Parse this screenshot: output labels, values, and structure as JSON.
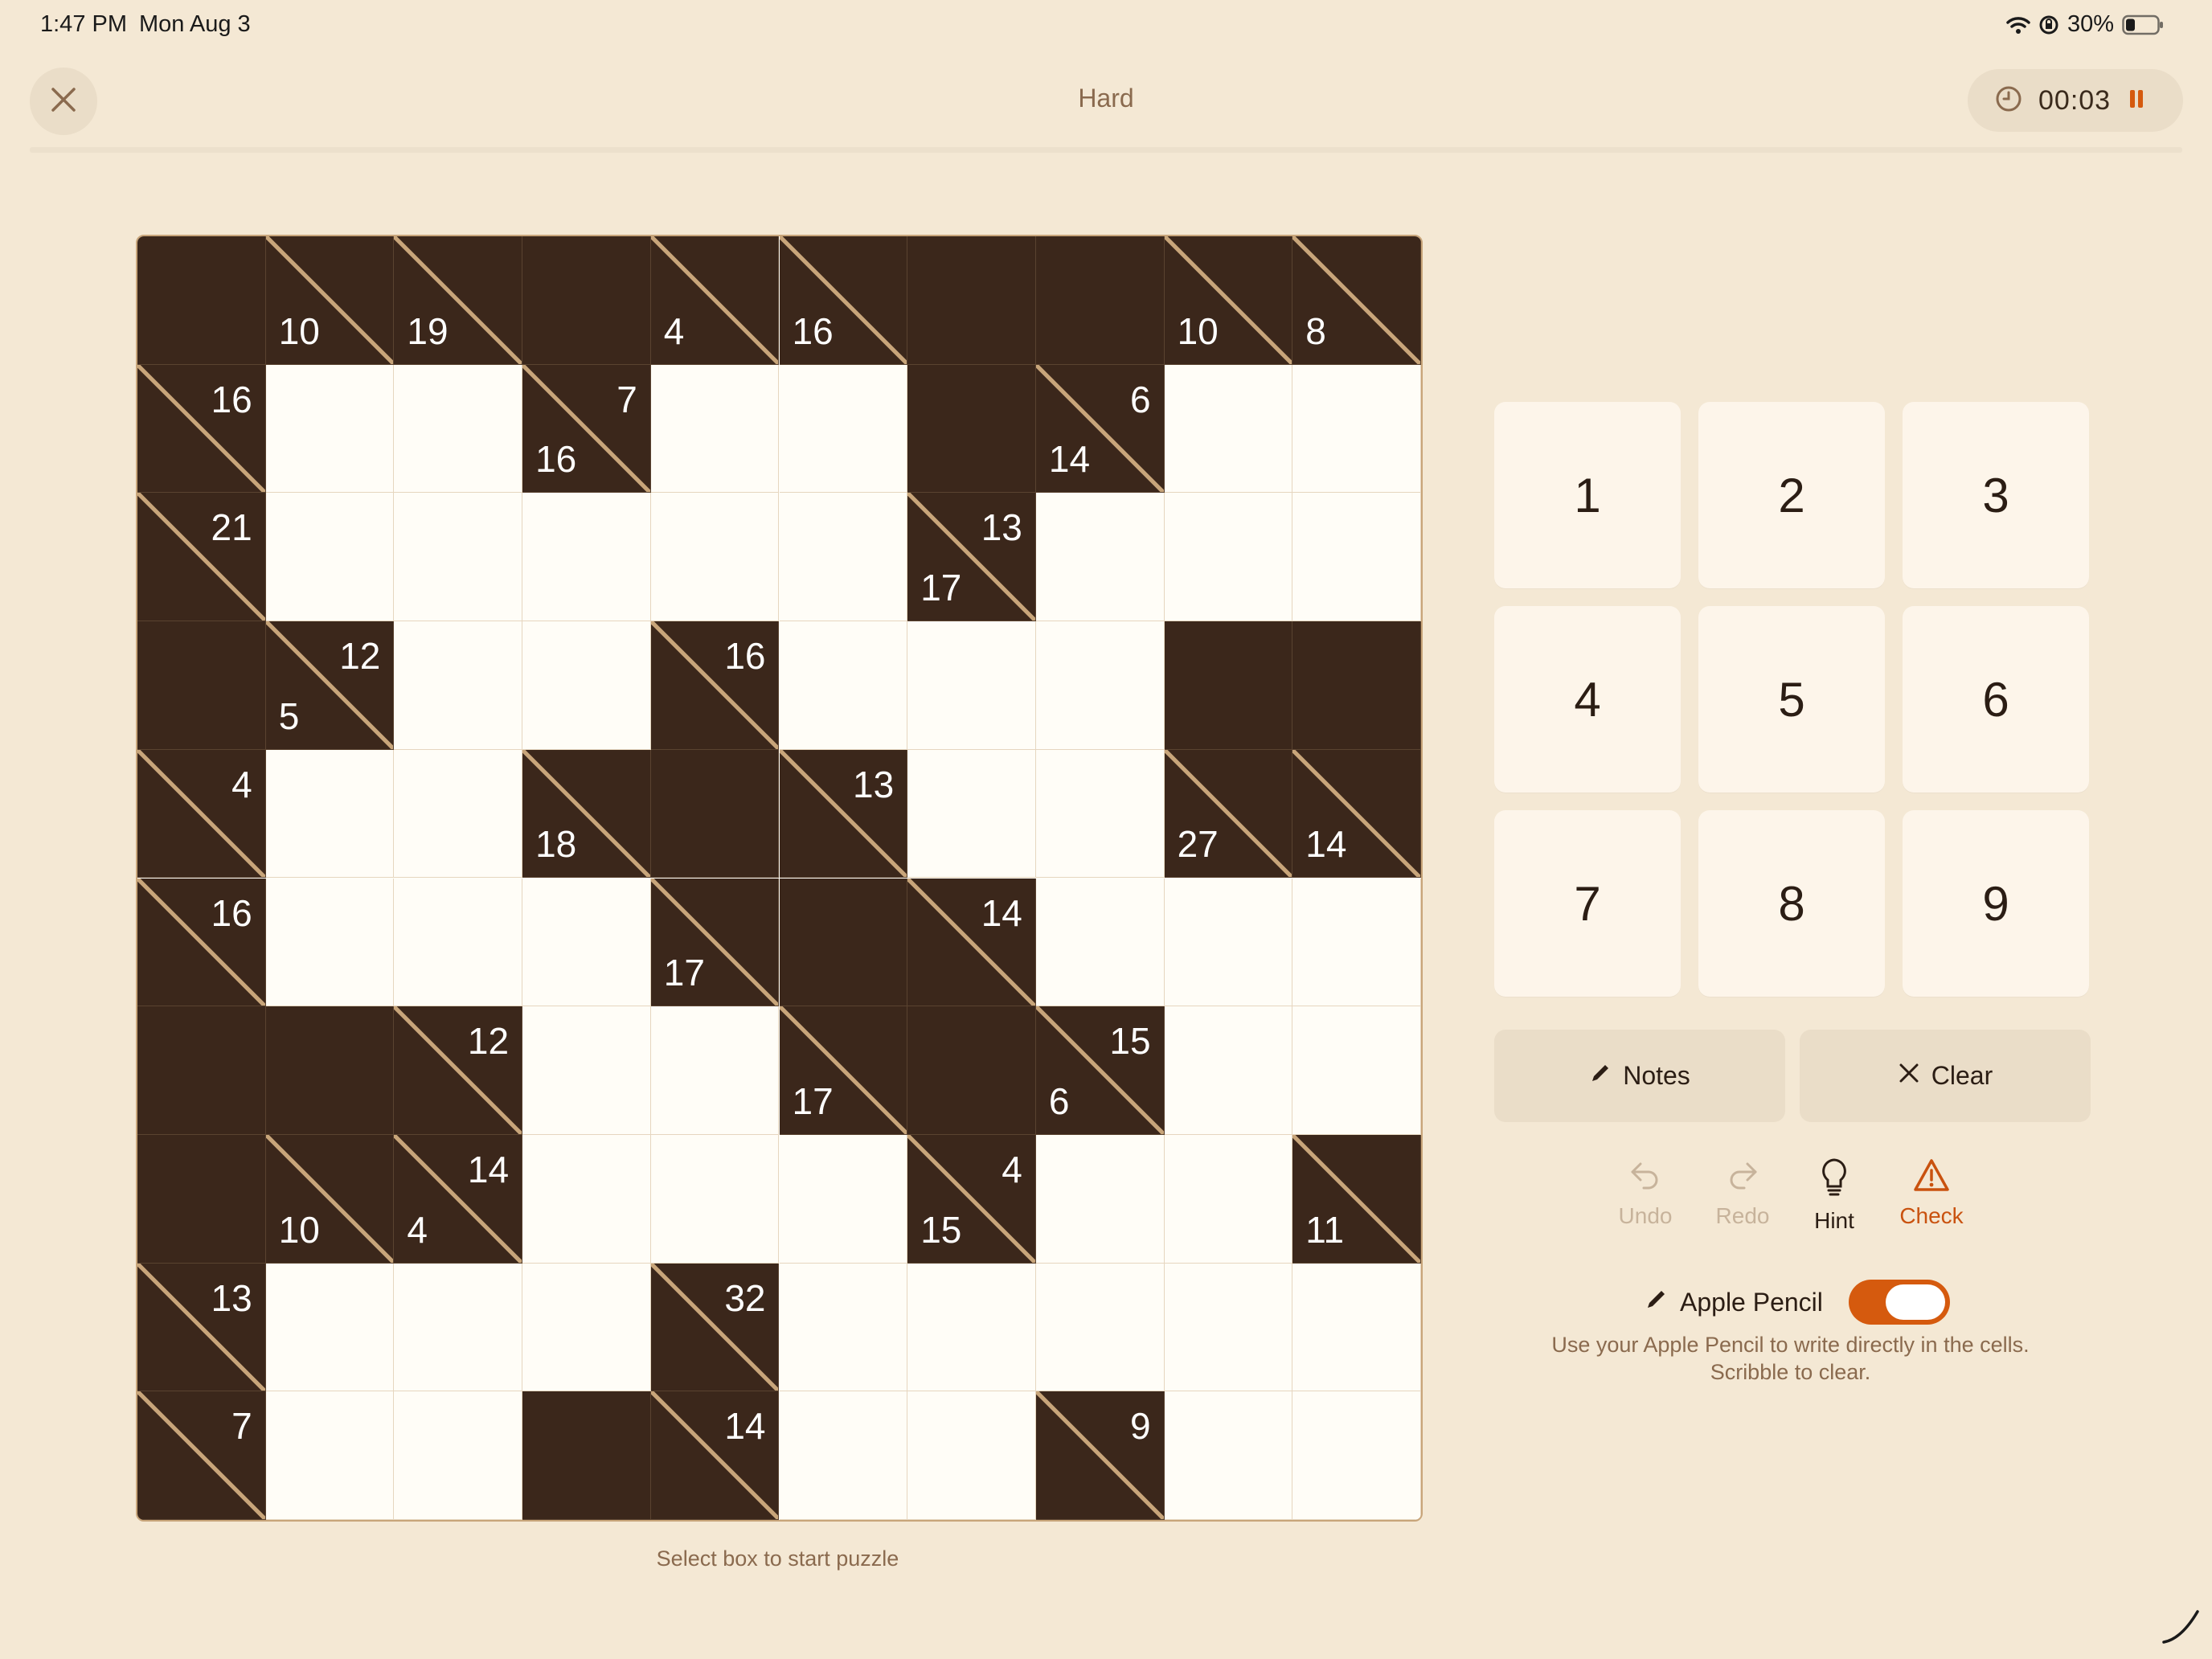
{
  "status_bar": {
    "time": "1:47 PM",
    "date": "Mon Aug 3",
    "battery": "30%"
  },
  "header": {
    "title": "Hard",
    "timer": "00:03"
  },
  "board": {
    "size": 10,
    "cells": [
      [
        "B",
        [
          null,
          10
        ],
        [
          null,
          19
        ],
        "B",
        [
          null,
          4
        ],
        [
          null,
          16
        ],
        "B",
        "B",
        [
          null,
          10
        ],
        [
          null,
          8
        ]
      ],
      [
        [
          16,
          null
        ],
        "W",
        "W",
        [
          7,
          16
        ],
        "W",
        "W",
        "B",
        [
          6,
          14
        ],
        "W",
        "W"
      ],
      [
        [
          21,
          null
        ],
        "W",
        "W",
        "W",
        "W",
        "W",
        [
          13,
          17
        ],
        "W",
        "W",
        "W"
      ],
      [
        "B",
        [
          12,
          5
        ],
        "W",
        "W",
        [
          16,
          null
        ],
        "W",
        "W",
        "W",
        "B",
        "B"
      ],
      [
        [
          4,
          null
        ],
        "W",
        "W",
        [
          null,
          18
        ],
        "B",
        [
          13,
          null
        ],
        "W",
        "W",
        [
          null,
          27
        ],
        [
          null,
          14
        ]
      ],
      [
        [
          16,
          null
        ],
        "W",
        "W",
        "W",
        [
          null,
          17
        ],
        "B",
        [
          14,
          null
        ],
        "W",
        "W",
        "W"
      ],
      [
        "B",
        "B",
        [
          12,
          null
        ],
        "W",
        "W",
        [
          null,
          17
        ],
        "B",
        [
          15,
          6
        ],
        "W",
        "W"
      ],
      [
        "B",
        [
          null,
          10
        ],
        [
          14,
          4
        ],
        "W",
        "W",
        "W",
        [
          4,
          15
        ],
        "W",
        "W",
        [
          null,
          11
        ]
      ],
      [
        [
          13,
          null
        ],
        "W",
        "W",
        "W",
        [
          32,
          null
        ],
        "W",
        "W",
        "W",
        "W",
        "W"
      ],
      [
        [
          7,
          null
        ],
        "W",
        "W",
        "B",
        [
          14,
          null
        ],
        "W",
        "W",
        [
          9,
          null
        ],
        "W",
        "W"
      ]
    ]
  },
  "select_hint": "Select box to start puzzle",
  "keypad": [
    "1",
    "2",
    "3",
    "4",
    "5",
    "6",
    "7",
    "8",
    "9"
  ],
  "actions": {
    "notes": "Notes",
    "clear": "Clear"
  },
  "tools": {
    "undo": "Undo",
    "redo": "Redo",
    "hint": "Hint",
    "check": "Check"
  },
  "apple_pencil": {
    "label": "Apple Pencil",
    "enabled": true,
    "description_line1": "Use your Apple Pencil to write directly in the cells.",
    "description_line2": "Scribble to clear."
  },
  "colors": {
    "background": "#f4e8d4",
    "dark_cell": "#3b271b",
    "accent": "#d55a0e",
    "diagonal": "#c8a57a"
  }
}
